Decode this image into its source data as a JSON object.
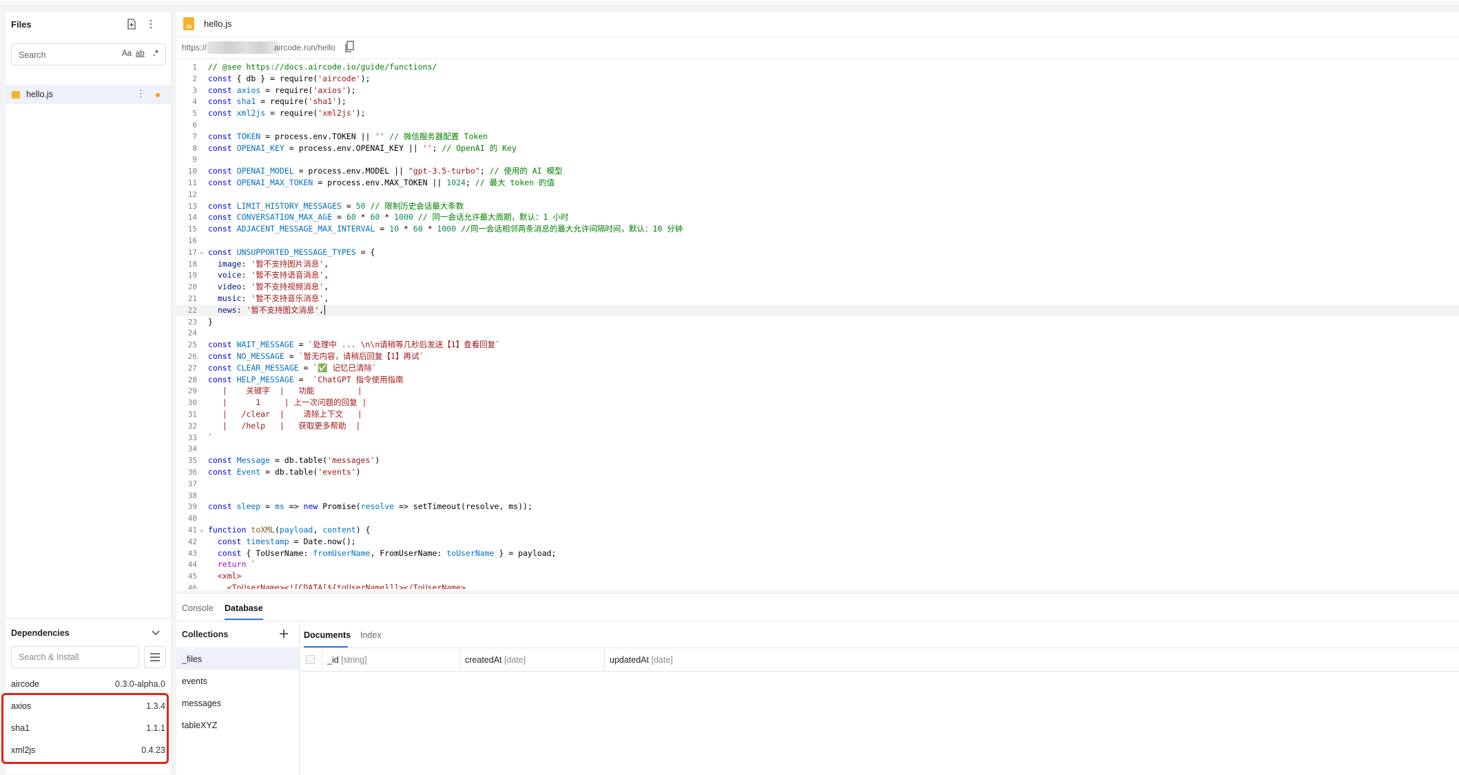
{
  "files_panel": {
    "title": "Files",
    "search_placeholder": "Search",
    "search_options": [
      "Aa",
      "ab",
      ".*"
    ],
    "files": [
      {
        "name": "hello.js"
      }
    ]
  },
  "editor": {
    "tab_title": "hello.js",
    "url_prefix": "https://",
    "url_suffix": "aircode.run/hello",
    "lines": [
      {
        "n": "1",
        "segs": [
          [
            "c",
            "// @see https://docs.aircode.io/guide/functions/"
          ]
        ]
      },
      {
        "n": "2",
        "segs": [
          [
            "k",
            "const"
          ],
          [
            "d",
            " { db } = require("
          ],
          [
            "s",
            "'aircode'"
          ],
          [
            "d",
            ");"
          ]
        ]
      },
      {
        "n": "3",
        "segs": [
          [
            "k",
            "const"
          ],
          [
            "d",
            " "
          ],
          [
            "v",
            "axios"
          ],
          [
            "d",
            " = require("
          ],
          [
            "s",
            "'axios'"
          ],
          [
            "d",
            ");"
          ]
        ]
      },
      {
        "n": "4",
        "segs": [
          [
            "k",
            "const"
          ],
          [
            "d",
            " "
          ],
          [
            "v",
            "sha1"
          ],
          [
            "d",
            " = require("
          ],
          [
            "s",
            "'sha1'"
          ],
          [
            "d",
            ");"
          ]
        ]
      },
      {
        "n": "5",
        "segs": [
          [
            "k",
            "const"
          ],
          [
            "d",
            " "
          ],
          [
            "v",
            "xml2js"
          ],
          [
            "d",
            " = require("
          ],
          [
            "s",
            "'xml2js'"
          ],
          [
            "d",
            ");"
          ]
        ]
      },
      {
        "n": "6",
        "segs": []
      },
      {
        "n": "7",
        "segs": [
          [
            "k",
            "const"
          ],
          [
            "d",
            " "
          ],
          [
            "v",
            "TOKEN"
          ],
          [
            "d",
            " = process.env.TOKEN || "
          ],
          [
            "s",
            "''"
          ],
          [
            "d",
            " "
          ],
          [
            "c",
            "// 微信服务器配置 Token"
          ]
        ]
      },
      {
        "n": "8",
        "segs": [
          [
            "k",
            "const"
          ],
          [
            "d",
            " "
          ],
          [
            "v",
            "OPENAI_KEY"
          ],
          [
            "d",
            " = process.env.OPENAI_KEY || "
          ],
          [
            "s",
            "''"
          ],
          [
            "d",
            "; "
          ],
          [
            "c",
            "// OpenAI 的 Key"
          ]
        ]
      },
      {
        "n": "9",
        "segs": []
      },
      {
        "n": "10",
        "segs": [
          [
            "k",
            "const"
          ],
          [
            "d",
            " "
          ],
          [
            "v",
            "OPENAI_MODEL"
          ],
          [
            "d",
            " = process.env.MODEL || "
          ],
          [
            "s",
            "\"gpt-3.5-turbo\""
          ],
          [
            "d",
            "; "
          ],
          [
            "c",
            "// 使用的 AI 模型"
          ]
        ]
      },
      {
        "n": "11",
        "segs": [
          [
            "k",
            "const"
          ],
          [
            "d",
            " "
          ],
          [
            "v",
            "OPENAI_MAX_TOKEN"
          ],
          [
            "d",
            " = process.env.MAX_TOKEN || "
          ],
          [
            "n",
            "1024"
          ],
          [
            "d",
            "; "
          ],
          [
            "c",
            "// 最大 token 的值"
          ]
        ]
      },
      {
        "n": "12",
        "segs": []
      },
      {
        "n": "13",
        "segs": [
          [
            "k",
            "const"
          ],
          [
            "d",
            " "
          ],
          [
            "v",
            "LIMIT_HISTORY_MESSAGES"
          ],
          [
            "d",
            " = "
          ],
          [
            "n",
            "50"
          ],
          [
            "d",
            " "
          ],
          [
            "c",
            "// 限制历史会话最大条数"
          ]
        ]
      },
      {
        "n": "14",
        "segs": [
          [
            "k",
            "const"
          ],
          [
            "d",
            " "
          ],
          [
            "v",
            "CONVERSATION_MAX_AGE"
          ],
          [
            "d",
            " = "
          ],
          [
            "n",
            "60"
          ],
          [
            "d",
            " * "
          ],
          [
            "n",
            "60"
          ],
          [
            "d",
            " * "
          ],
          [
            "n",
            "1000"
          ],
          [
            "d",
            " "
          ],
          [
            "c",
            "// 同一会话允许最大周期，默认：1 小时"
          ]
        ]
      },
      {
        "n": "15",
        "segs": [
          [
            "k",
            "const"
          ],
          [
            "d",
            " "
          ],
          [
            "v",
            "ADJACENT_MESSAGE_MAX_INTERVAL"
          ],
          [
            "d",
            " = "
          ],
          [
            "n",
            "10"
          ],
          [
            "d",
            " * "
          ],
          [
            "n",
            "60"
          ],
          [
            "d",
            " * "
          ],
          [
            "n",
            "1000"
          ],
          [
            "d",
            " "
          ],
          [
            "c",
            "//同一会话相邻两条消息的最大允许间隔时间，默认：10 分钟"
          ]
        ]
      },
      {
        "n": "16",
        "segs": []
      },
      {
        "n": "17",
        "fold": true,
        "segs": [
          [
            "k",
            "const"
          ],
          [
            "d",
            " "
          ],
          [
            "v",
            "UNSUPPORTED_MESSAGE_TYPES"
          ],
          [
            "d",
            " = {"
          ]
        ]
      },
      {
        "n": "18",
        "segs": [
          [
            "d",
            "  "
          ],
          [
            "p",
            "image"
          ],
          [
            "d",
            ": "
          ],
          [
            "s",
            "'暂不支持图片消息'"
          ],
          [
            "d",
            ","
          ]
        ]
      },
      {
        "n": "19",
        "segs": [
          [
            "d",
            "  "
          ],
          [
            "p",
            "voice"
          ],
          [
            "d",
            ": "
          ],
          [
            "s",
            "'暂不支持语音消息'"
          ],
          [
            "d",
            ","
          ]
        ]
      },
      {
        "n": "20",
        "segs": [
          [
            "d",
            "  "
          ],
          [
            "p",
            "video"
          ],
          [
            "d",
            ": "
          ],
          [
            "s",
            "'暂不支持视频消息'"
          ],
          [
            "d",
            ","
          ]
        ]
      },
      {
        "n": "21",
        "segs": [
          [
            "d",
            "  "
          ],
          [
            "p",
            "music"
          ],
          [
            "d",
            ": "
          ],
          [
            "s",
            "'暂不支持音乐消息'"
          ],
          [
            "d",
            ","
          ]
        ]
      },
      {
        "n": "22",
        "active": true,
        "cursor": true,
        "segs": [
          [
            "d",
            "  "
          ],
          [
            "p",
            "news"
          ],
          [
            "d",
            ": "
          ],
          [
            "s",
            "'暂不支持图文消息'"
          ],
          [
            "d",
            ","
          ]
        ]
      },
      {
        "n": "23",
        "segs": [
          [
            "d",
            "}"
          ]
        ]
      },
      {
        "n": "24",
        "segs": []
      },
      {
        "n": "25",
        "segs": [
          [
            "k",
            "const"
          ],
          [
            "d",
            " "
          ],
          [
            "v",
            "WAIT_MESSAGE"
          ],
          [
            "d",
            " = "
          ],
          [
            "s",
            "`处理中 ... \\n\\n请稍等几秒后发送【1】查看回复`"
          ]
        ]
      },
      {
        "n": "26",
        "segs": [
          [
            "k",
            "const"
          ],
          [
            "d",
            " "
          ],
          [
            "v",
            "NO_MESSAGE"
          ],
          [
            "d",
            " = "
          ],
          [
            "s",
            "`暂无内容，请稍后回复【1】再试`"
          ]
        ]
      },
      {
        "n": "27",
        "segs": [
          [
            "k",
            "const"
          ],
          [
            "d",
            " "
          ],
          [
            "v",
            "CLEAR_MESSAGE"
          ],
          [
            "d",
            " = "
          ],
          [
            "s",
            "`✅ 记忆已清除`"
          ]
        ]
      },
      {
        "n": "28",
        "segs": [
          [
            "k",
            "const"
          ],
          [
            "d",
            " "
          ],
          [
            "v",
            "HELP_MESSAGE"
          ],
          [
            "d",
            " =  "
          ],
          [
            "s",
            "`ChatGPT 指令使用指南"
          ]
        ]
      },
      {
        "n": "29",
        "segs": [
          [
            "s",
            "   |    关键字  |   功能         |"
          ]
        ]
      },
      {
        "n": "30",
        "segs": [
          [
            "s",
            "   |      1     | 上一次问题的回复 |"
          ]
        ]
      },
      {
        "n": "31",
        "segs": [
          [
            "s",
            "   |   /clear  |    清除上下文   |"
          ]
        ]
      },
      {
        "n": "32",
        "segs": [
          [
            "s",
            "   |   /help   |   获取更多帮助  |"
          ]
        ]
      },
      {
        "n": "33",
        "segs": [
          [
            "s",
            "`"
          ]
        ]
      },
      {
        "n": "34",
        "segs": []
      },
      {
        "n": "35",
        "segs": [
          [
            "k",
            "const"
          ],
          [
            "d",
            " "
          ],
          [
            "v",
            "Message"
          ],
          [
            "d",
            " = db.table("
          ],
          [
            "s",
            "'messages'"
          ],
          [
            "d",
            ")"
          ]
        ]
      },
      {
        "n": "36",
        "segs": [
          [
            "k",
            "const"
          ],
          [
            "d",
            " "
          ],
          [
            "v",
            "Event"
          ],
          [
            "d",
            " = db.table("
          ],
          [
            "s",
            "'events'"
          ],
          [
            "d",
            ")"
          ]
        ]
      },
      {
        "n": "37",
        "segs": []
      },
      {
        "n": "38",
        "segs": []
      },
      {
        "n": "39",
        "segs": [
          [
            "k",
            "const"
          ],
          [
            "d",
            " "
          ],
          [
            "v",
            "sleep"
          ],
          [
            "d",
            " = "
          ],
          [
            "v",
            "ms"
          ],
          [
            "d",
            " => "
          ],
          [
            "k",
            "new"
          ],
          [
            "d",
            " Promise("
          ],
          [
            "v",
            "resolve"
          ],
          [
            "d",
            " => setTimeout(resolve, ms));"
          ]
        ]
      },
      {
        "n": "40",
        "segs": []
      },
      {
        "n": "41",
        "fold": true,
        "segs": [
          [
            "k",
            "function"
          ],
          [
            "d",
            " "
          ],
          [
            "f",
            "toXML"
          ],
          [
            "d",
            "("
          ],
          [
            "v",
            "payload"
          ],
          [
            "d",
            ", "
          ],
          [
            "v",
            "content"
          ],
          [
            "d",
            ") {"
          ]
        ]
      },
      {
        "n": "42",
        "segs": [
          [
            "d",
            "  "
          ],
          [
            "k",
            "const"
          ],
          [
            "d",
            " "
          ],
          [
            "v",
            "timestamp"
          ],
          [
            "d",
            " = Date.now();"
          ]
        ]
      },
      {
        "n": "43",
        "segs": [
          [
            "d",
            "  "
          ],
          [
            "k",
            "const"
          ],
          [
            "d",
            " { ToUserName: "
          ],
          [
            "v",
            "fromUserName"
          ],
          [
            "d",
            ", FromUserName: "
          ],
          [
            "v",
            "toUserName"
          ],
          [
            "d",
            " } = payload;"
          ]
        ]
      },
      {
        "n": "44",
        "segs": [
          [
            "d",
            "  "
          ],
          [
            "kw",
            "return"
          ],
          [
            "d",
            " "
          ],
          [
            "s",
            "`"
          ]
        ]
      },
      {
        "n": "45",
        "segs": [
          [
            "d",
            "  "
          ],
          [
            "s",
            "<xml>"
          ]
        ]
      },
      {
        "n": "46",
        "segs": [
          [
            "d",
            "    "
          ],
          [
            "s",
            "<ToUserName><![CDATA[${toUserName}]]></ToUserName>"
          ]
        ]
      }
    ]
  },
  "bottom_panel": {
    "tabs": [
      "Console",
      "Database"
    ],
    "active_tab": "Database",
    "collections_title": "Collections",
    "collections": [
      "_files",
      "events",
      "messages",
      "tableXYZ"
    ],
    "selected_collection": "_files",
    "doc_tabs": [
      "Documents",
      "Index"
    ],
    "columns": [
      {
        "name": "_id",
        "type": "[string]"
      },
      {
        "name": "createdAt",
        "type": "[date]"
      },
      {
        "name": "updatedAt",
        "type": "[date]"
      }
    ]
  },
  "dependencies": {
    "title": "Dependencies",
    "search_placeholder": "Search & Install",
    "items": [
      {
        "name": "aircode",
        "version": "0.3.0-alpha.0"
      },
      {
        "name": "axios",
        "version": "1.3.4"
      },
      {
        "name": "sha1",
        "version": "1.1.1"
      },
      {
        "name": "xml2js",
        "version": "0.4.23"
      }
    ]
  },
  "colors": {
    "accent": "#2f6feb",
    "highlight": "#e2231a",
    "file_badge": "#f0b429",
    "unsaved_dot": "#f59e0b"
  }
}
